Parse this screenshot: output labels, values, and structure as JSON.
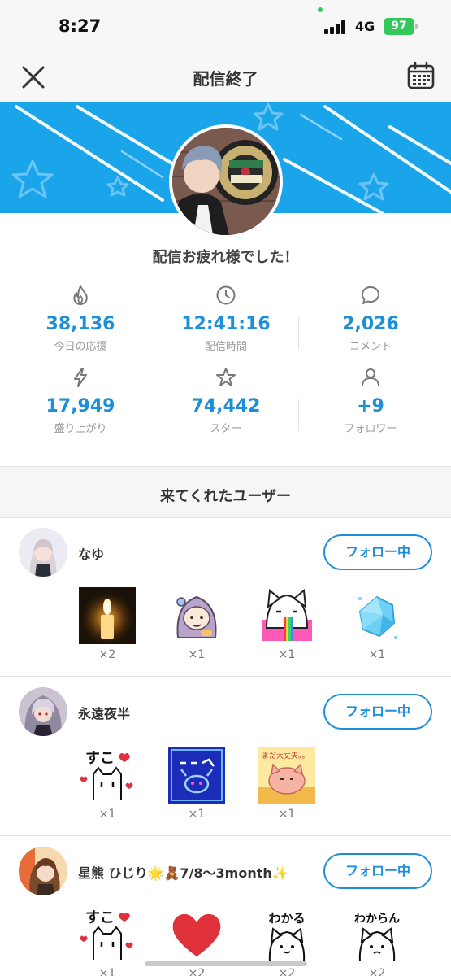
{
  "status_bar": {
    "time": "8:27",
    "network": "4G",
    "battery": "97"
  },
  "header": {
    "title": "配信終了"
  },
  "summary": {
    "message": "配信お疲れ様でした！"
  },
  "stats": [
    {
      "icon": "flame-icon",
      "value": "38,136",
      "label": "今日の応援"
    },
    {
      "icon": "clock-icon",
      "value": "12:41:16",
      "label": "配信時間"
    },
    {
      "icon": "comment-bubble-icon",
      "value": "2,026",
      "label": "コメント"
    },
    {
      "icon": "lightning-icon",
      "value": "17,949",
      "label": "盛り上がり"
    },
    {
      "icon": "star-icon",
      "value": "74,442",
      "label": "スター"
    },
    {
      "icon": "person-icon",
      "value": "+9",
      "label": "フォロワー"
    }
  ],
  "visitors": {
    "title": "来てくれたユーザー",
    "follow_label": "フォロー中",
    "users": [
      {
        "name": "なゆ",
        "gifts": [
          {
            "icon": "candle-gift-icon",
            "count": "×2"
          },
          {
            "icon": "hooded-character-gift-icon",
            "count": "×1"
          },
          {
            "icon": "rainbow-cat-gift-icon",
            "count": "×1"
          },
          {
            "icon": "blue-gem-gift-icon",
            "count": "×1"
          }
        ]
      },
      {
        "name": "永遠夜半",
        "gifts": [
          {
            "icon": "suko-cat-gift-icon",
            "count": "×1",
            "text": "すこ"
          },
          {
            "icon": "neon-sign-gift-icon",
            "count": "×1"
          },
          {
            "icon": "relaxing-cat-gift-icon",
            "count": "×1",
            "text": "まだ大丈夫。。"
          }
        ]
      },
      {
        "name": "星熊 ひじり🌟🧸7/8〜3month✨",
        "gifts": [
          {
            "icon": "suko-cat-gift-icon",
            "count": "×1",
            "text": "すこ"
          },
          {
            "icon": "red-heart-gift-icon",
            "count": "×2"
          },
          {
            "icon": "wakaru-cat-gift-icon",
            "count": "×2",
            "text": "わかる"
          },
          {
            "icon": "wakaran-cat-gift-icon",
            "count": "×2",
            "text": "わからん"
          }
        ]
      }
    ]
  }
}
